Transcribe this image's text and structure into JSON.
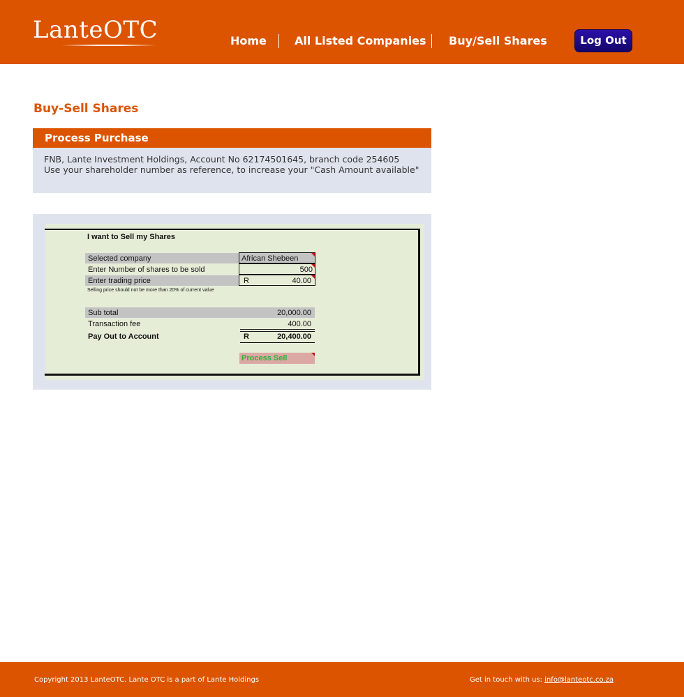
{
  "header": {
    "logo_text": "LanteOTC",
    "nav": [
      "Home",
      "All Listed Companies",
      "Buy/Sell Shares"
    ],
    "logout_label": "Log Out"
  },
  "main": {
    "page_title": "Buy-Sell Shares",
    "process_panel": {
      "title": "Process Purchase",
      "line1": "FNB, Lante Investment Holdings, Account No 62174501645, branch code 254605",
      "line2": "Use your shareholder number as reference, to increase your \"Cash Amount available\""
    },
    "sell_form": {
      "heading": "I want to Sell my Shares",
      "selected_company_label": "Selected company",
      "selected_company_value": "African Shebeen",
      "shares_label": "Enter Number of shares to be sold",
      "shares_value": "500",
      "price_label": "Enter trading price",
      "price_currency": "R",
      "price_value": "40.00",
      "price_note": "Selling price should not be more than 20% of current value",
      "subtotal_label": "Sub total",
      "subtotal_value": "20,000.00",
      "fee_label": "Transaction fee",
      "fee_value": "400.00",
      "payout_label": "Pay Out to Account",
      "payout_currency": "R",
      "payout_value": "20,400.00",
      "process_button": "Process Sell"
    }
  },
  "footer": {
    "copyright": "Copyright 2013 LanteOTC. Lante OTC is a part of Lante Holdings",
    "contact_label": "Get in touch with us:",
    "contact_email": "info@lanteotc.co.za"
  },
  "colors": {
    "brand_orange": "#dc5400",
    "panel_bg": "#dfe3ee",
    "logout_blue": "#1e0c8c",
    "sheet_green": "#e5edd7"
  }
}
